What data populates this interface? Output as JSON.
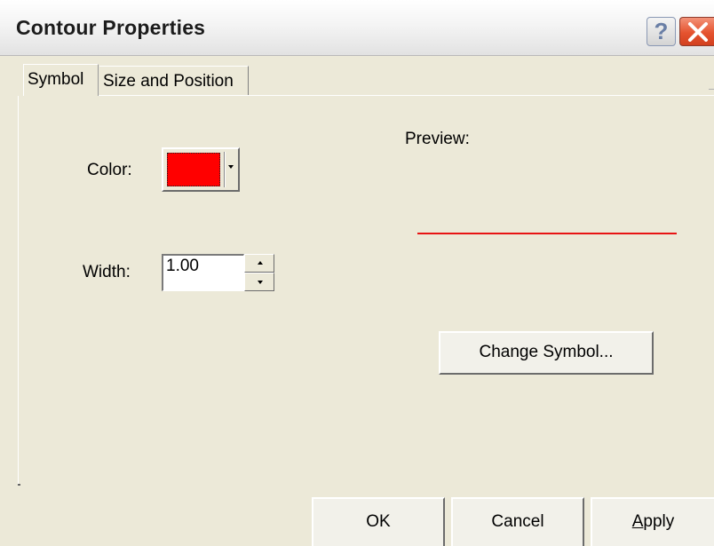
{
  "window": {
    "title": "Contour Properties",
    "help_label": "?",
    "close_label": "Close"
  },
  "tabs": [
    {
      "label": "Symbol",
      "selected": true
    },
    {
      "label": "Size and Position",
      "selected": false
    }
  ],
  "symbol": {
    "color_label": "Color:",
    "color_value": "#ff0000",
    "width_label": "Width:",
    "width_value": "1.00",
    "preview_label": "Preview:",
    "preview_line_color": "#e81414",
    "change_symbol_label": "Change Symbol..."
  },
  "footer": {
    "ok_label": "OK",
    "cancel_label": "Cancel",
    "apply_label_first": "A",
    "apply_label_rest": "pply"
  },
  "icons": {
    "help": "question-mark-icon",
    "close": "close-x-icon",
    "dropdown": "caret-down-icon",
    "spin_up": "caret-up-icon",
    "spin_down": "caret-down-icon"
  }
}
